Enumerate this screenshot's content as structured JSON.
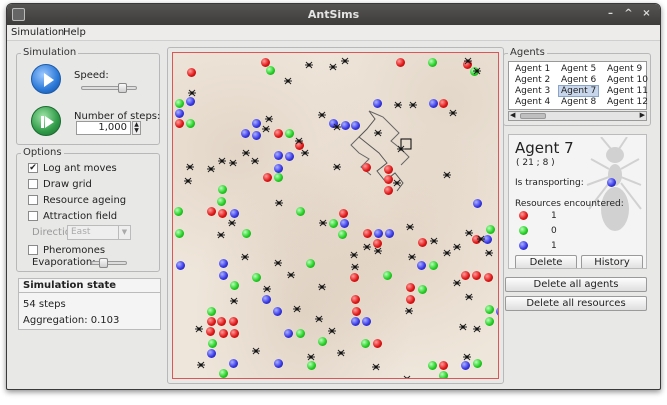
{
  "window": {
    "title": "AntSims",
    "controls": [
      "–",
      "^",
      "×"
    ]
  },
  "menu": {
    "items": [
      "Simulation",
      "Help"
    ]
  },
  "simulation": {
    "legend": "Simulation",
    "speed_label": "Speed:",
    "steps_label": "Number of steps:",
    "steps_value": "1,000",
    "speed_level": 0.72
  },
  "options": {
    "legend": "Options",
    "items": [
      {
        "label": "Log ant moves",
        "checked": true
      },
      {
        "label": "Draw grid",
        "checked": false
      },
      {
        "label": "Resource ageing",
        "checked": false
      },
      {
        "label": "Attraction field",
        "checked": false
      }
    ],
    "direction_label": "Direction:",
    "direction_value": "East",
    "pheromones_label": "Pheromones",
    "evaporation_label": "Evaporation:",
    "evaporation_level": 0.3
  },
  "state": {
    "title": "Simulation state",
    "steps": "54 steps",
    "aggregation": "Aggregation: 0.103"
  },
  "agents": {
    "legend": "Agents",
    "grid": [
      [
        "Agent 1",
        "Agent 5",
        "Agent 9"
      ],
      [
        "Agent 2",
        "Agent 6",
        "Agent 10"
      ],
      [
        "Agent 3",
        "Agent 7",
        "Agent 11"
      ],
      [
        "Agent 4",
        "Agent 8",
        "Agent 12"
      ]
    ],
    "selected": "Agent 7"
  },
  "info": {
    "name": "Agent 7",
    "coords": "( 21 ; 8 )",
    "transporting_label": "Is transporting:",
    "transporting_color": "#2a2ae0",
    "resources_label": "Resources encountered:",
    "resources": [
      {
        "color": "red",
        "count": "1"
      },
      {
        "color": "green",
        "count": "0"
      },
      {
        "color": "blue",
        "count": "1"
      }
    ],
    "delete_label": "Delete",
    "history_label": "History"
  },
  "buttons": {
    "delete_all_agents": "Delete all agents",
    "delete_all_resources": "Delete all resources"
  },
  "colors": {
    "red": "#e01818",
    "green": "#25d025",
    "blue": "#3a3ae8",
    "accent_play": "#2b79d8",
    "accent_step": "#2f9a48"
  }
}
